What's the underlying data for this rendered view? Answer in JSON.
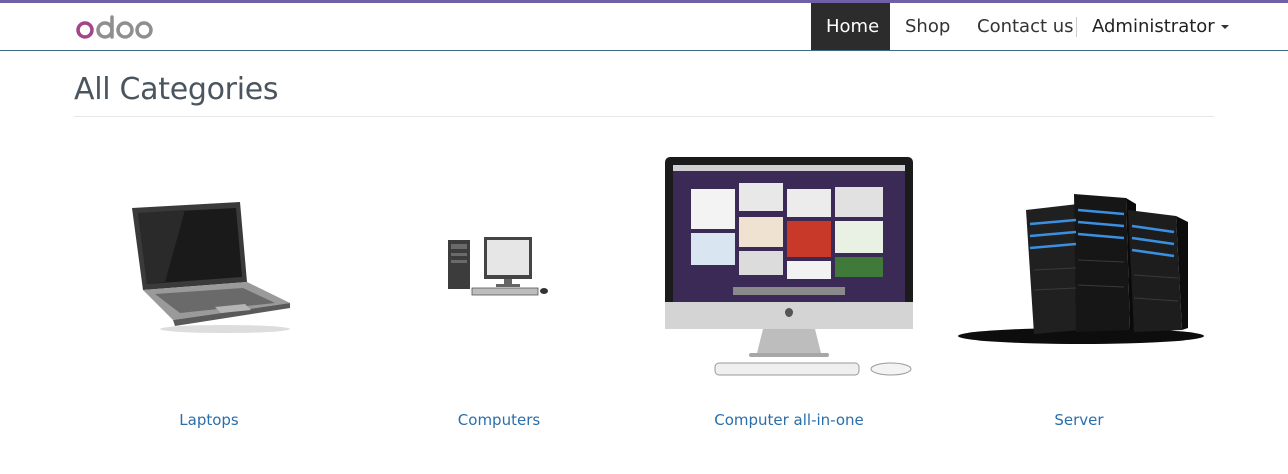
{
  "brand": {
    "logo_text": "odoo"
  },
  "nav": {
    "home": "Home",
    "shop": "Shop",
    "contact": "Contact us",
    "user": "Administrator"
  },
  "page": {
    "title": "All Categories"
  },
  "categories": [
    {
      "label": "Laptops",
      "image": "laptop"
    },
    {
      "label": "Computers",
      "image": "desktop-computer"
    },
    {
      "label": "Computer all-in-one",
      "image": "all-in-one-computer"
    },
    {
      "label": "Server",
      "image": "server-rack"
    }
  ],
  "colors": {
    "accent": "#6f5fa8",
    "link": "#2a6eaa",
    "active_nav": "#2c2c2c"
  }
}
